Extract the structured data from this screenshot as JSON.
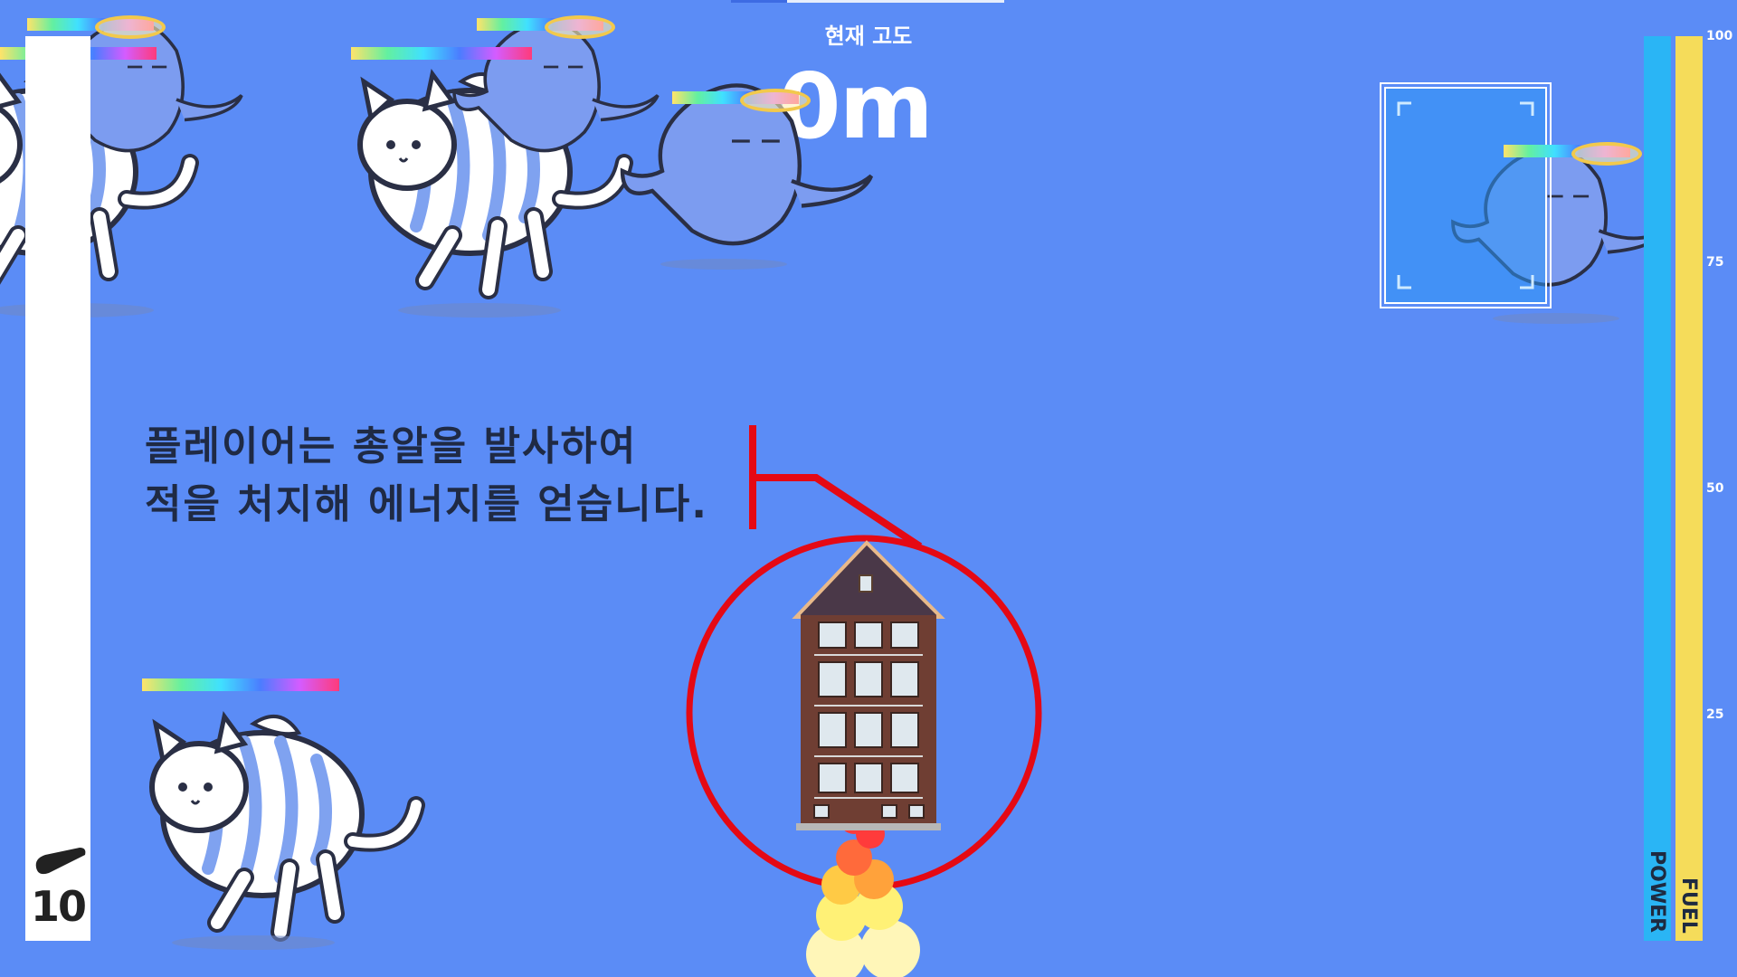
{
  "hud": {
    "altitude_label": "현재 고도",
    "altitude_value": "0m",
    "ammo_count": "10",
    "power_label": "POWER",
    "fuel_label": "FUEL",
    "gauge_ticks": [
      "100",
      "75",
      "50",
      "25"
    ]
  },
  "tutorial": {
    "line1": "플레이어는 총알을 발사하여",
    "line2": "적을 처지해 에너지를 얻습니다."
  },
  "colors": {
    "background": "#5b8cf6",
    "power": "#2ab5f5",
    "fuel": "#f5dc5a",
    "highlight_circle": "#e50914",
    "enemy_tint": "#7fa2f0"
  },
  "entities": {
    "enemies": [
      "flying-cat",
      "ghost"
    ],
    "player": "building-rocket"
  }
}
